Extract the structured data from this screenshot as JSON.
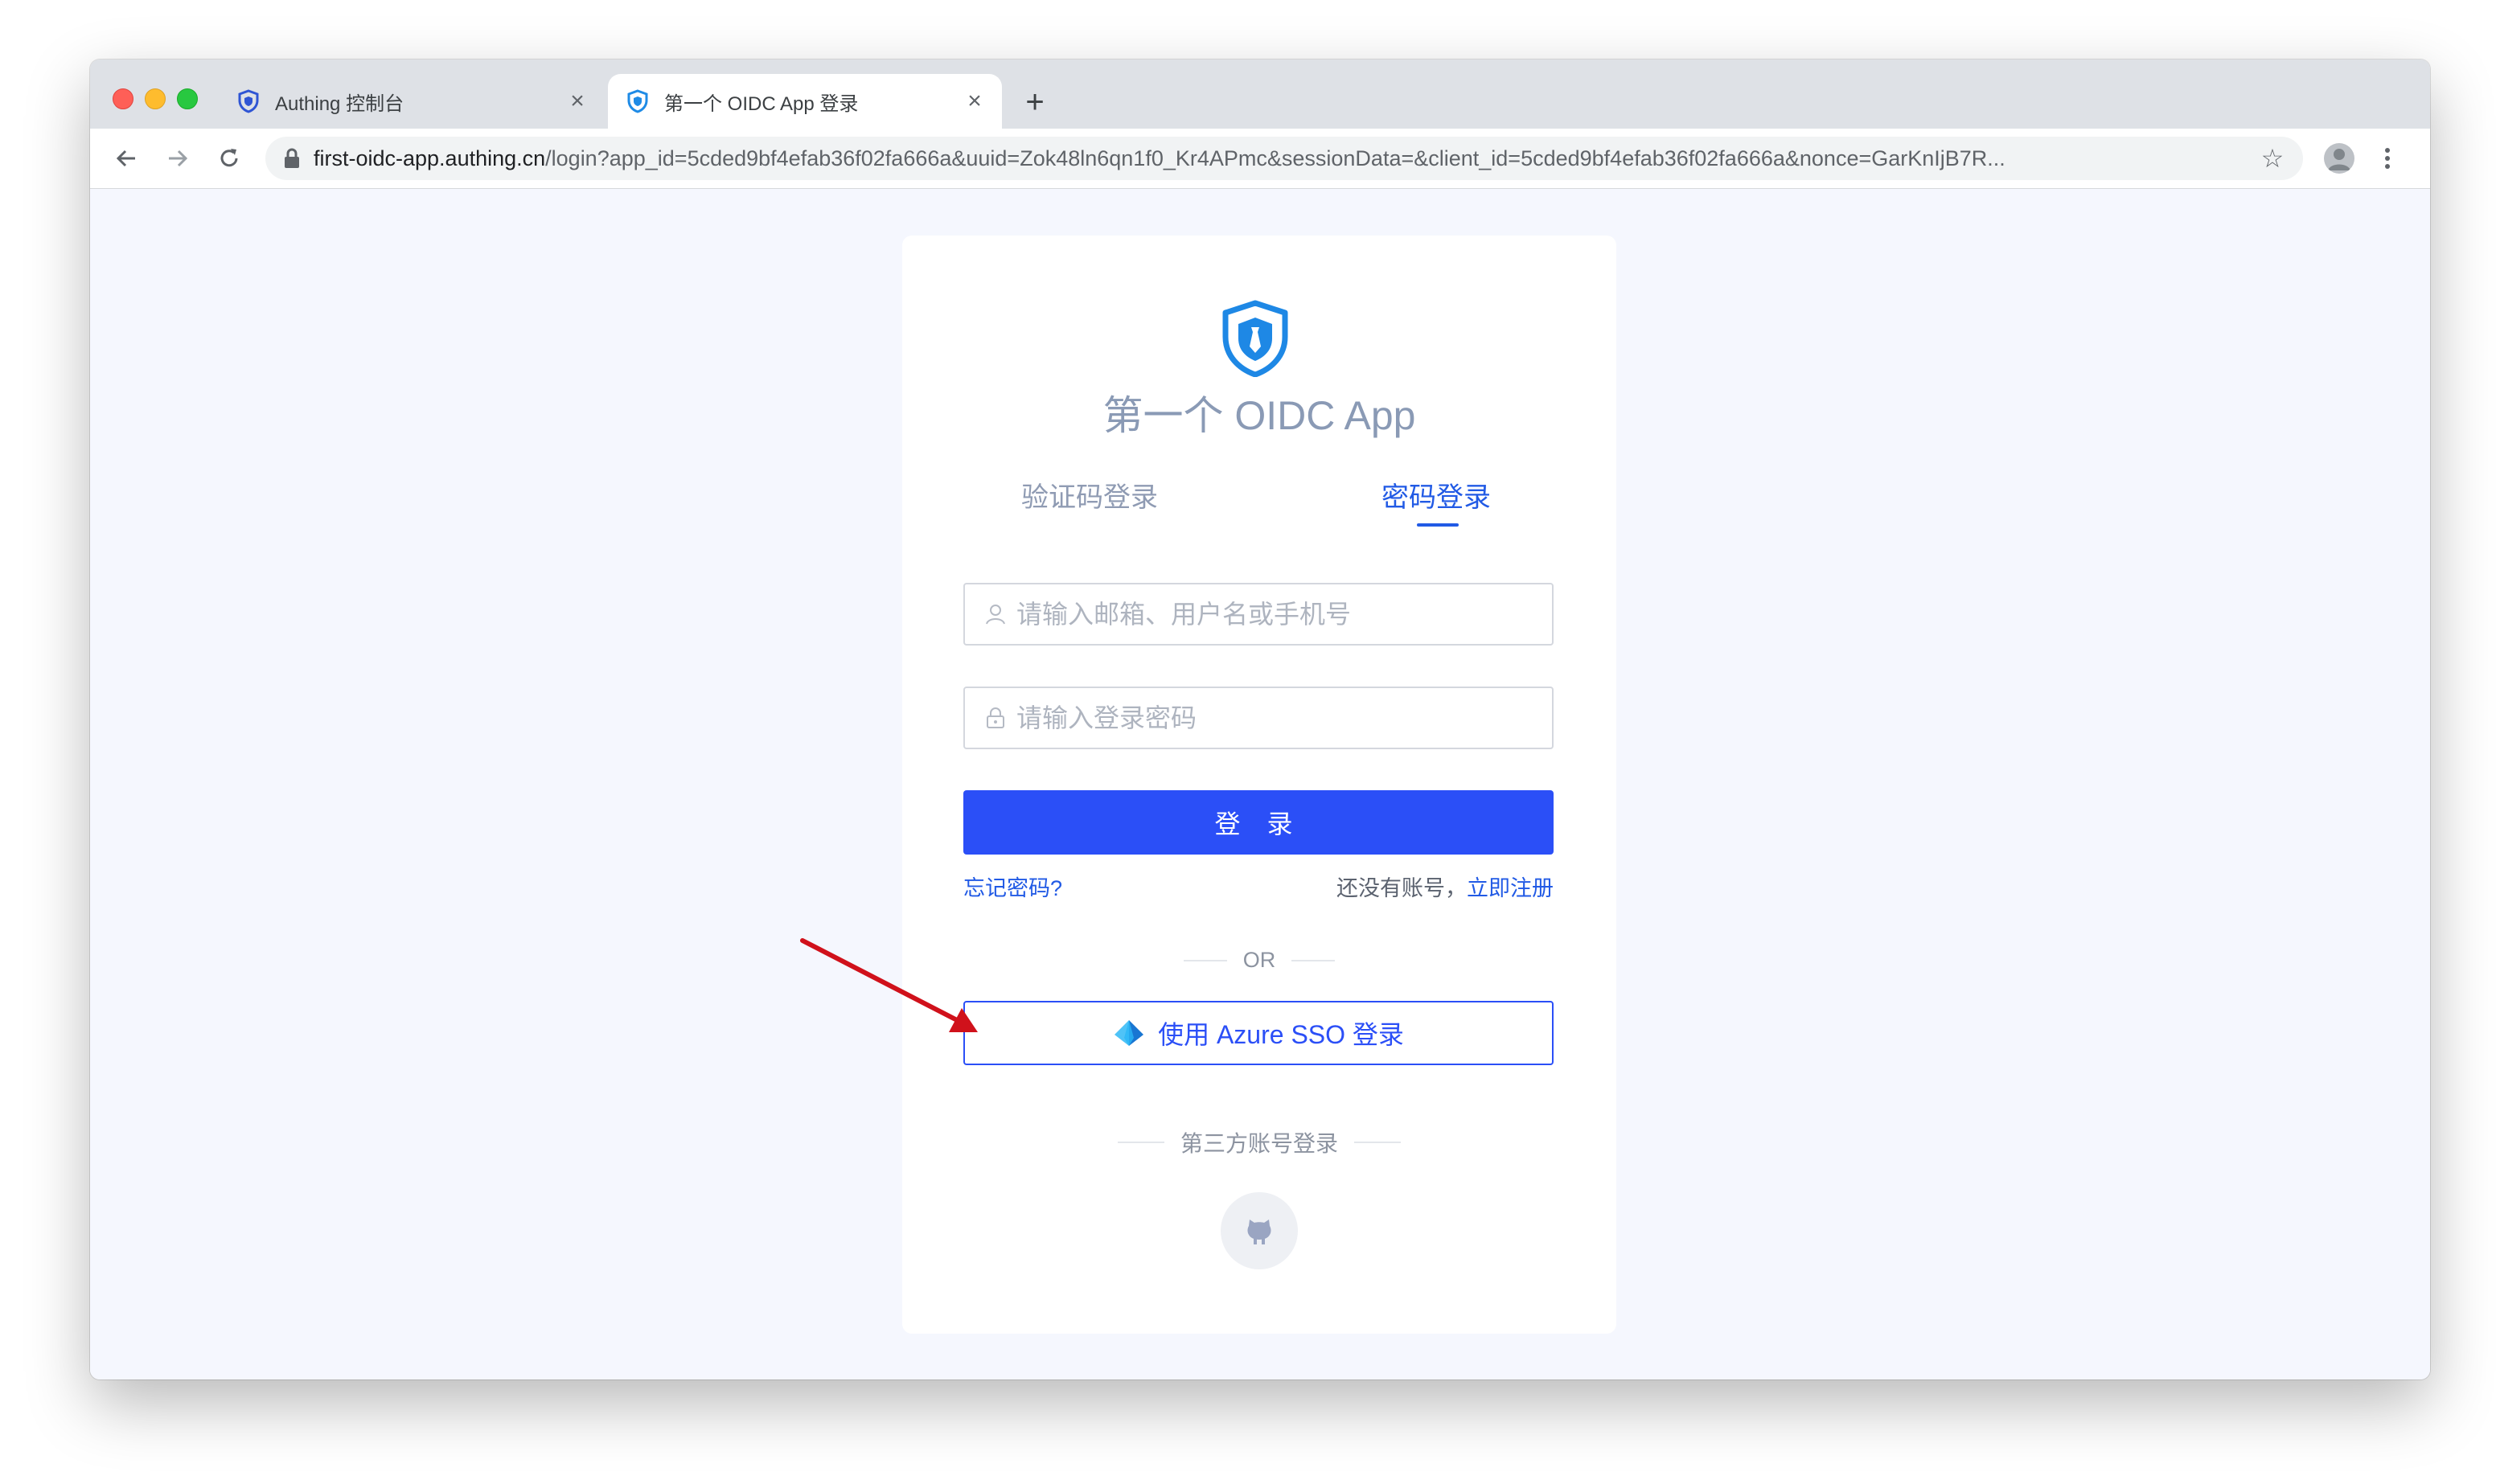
{
  "browser": {
    "tabs": [
      {
        "title": "Authing 控制台",
        "active": false,
        "icon": "authing-shield-icon"
      },
      {
        "title": "第一个 OIDC App 登录",
        "active": true,
        "icon": "authing-shield-icon"
      }
    ],
    "new_tab_label": "+",
    "url_host": "first-oidc-app.authing.cn",
    "url_path": "/login?app_id=5cded9bf4efab36f02fa666a&uuid=Zok48ln6qn1f0_Kr4APmc&sessionData=&client_id=5cded9bf4efab36f02fa666a&nonce=GarKnIjB7R..."
  },
  "login": {
    "app_title": "第一个 OIDC App",
    "tabs": {
      "code_label": "验证码登录",
      "password_label": "密码登录",
      "active": "password"
    },
    "username_placeholder": "请输入邮箱、用户名或手机号",
    "password_placeholder": "请输入登录密码",
    "submit_label": "登 录",
    "forgot_label": "忘记密码?",
    "no_account_text": "还没有账号，",
    "register_label": "立即注册",
    "or_label": "OR",
    "sso_label": "使用 Azure SSO 登录",
    "third_party_label": "第三方账号登录",
    "social_providers": [
      "github-icon"
    ]
  },
  "colors": {
    "primary": "#2b4ff7",
    "link": "#215ae5",
    "annotation_arrow": "#d0111b",
    "page_bg": "#f5f7fe"
  }
}
